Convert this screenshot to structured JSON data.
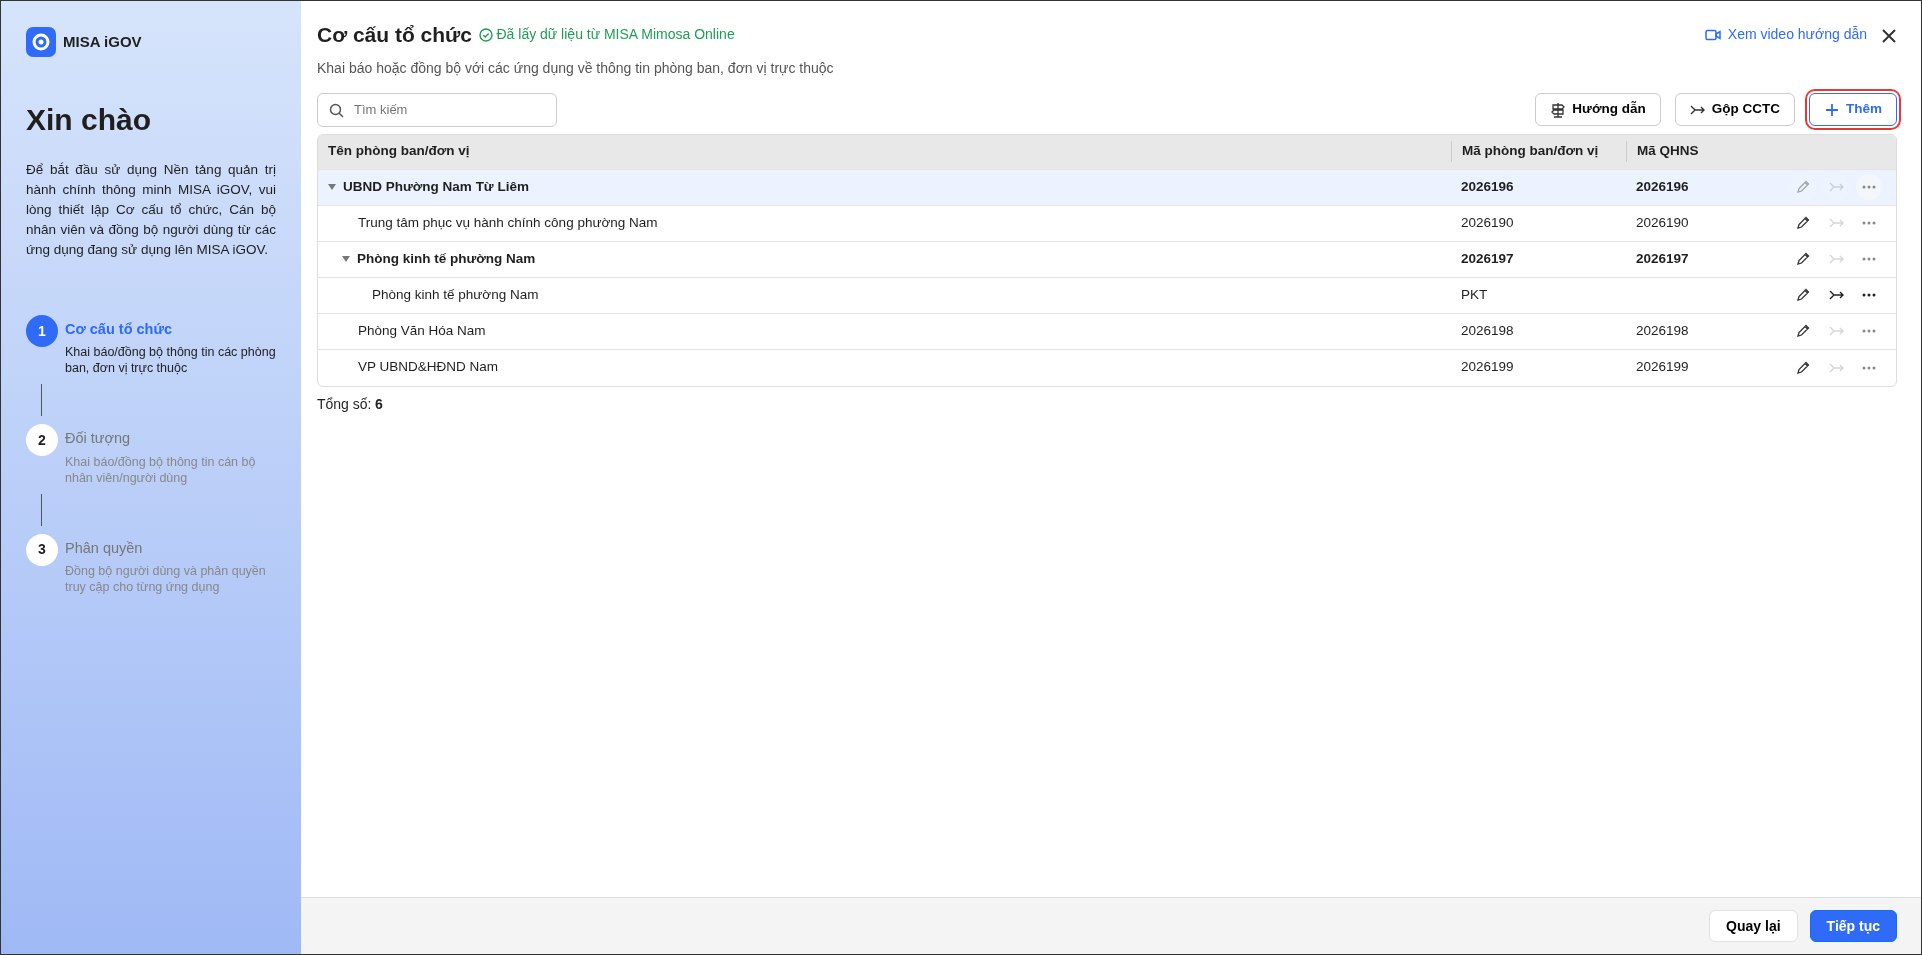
{
  "sidebar": {
    "brand": "MISA iGOV",
    "greeting": "Xin chào",
    "intro": "Để bắt đầu sử dụng Nền tảng quản trị hành chính thông minh MISA iGOV, vui lòng thiết lập Cơ cấu tổ chức, Cán bộ nhân viên và đồng bộ người dùng từ các ứng dụng đang sử dụng lên MISA iGOV.",
    "steps": [
      {
        "number": "1",
        "title": "Cơ cấu tổ chức",
        "description": "Khai báo/đồng bộ thông tin các phòng ban, đơn vị trực thuộc",
        "selected": true
      },
      {
        "number": "2",
        "title": "Đối tượng",
        "description": "Khai báo/đồng bộ thông tin cán bộ nhân viên/người dùng",
        "selected": false
      },
      {
        "number": "3",
        "title": "Phân quyền",
        "description": "Đồng bộ người dùng và phân quyền truy cập cho từng ứng dụng",
        "selected": false
      }
    ]
  },
  "header": {
    "title": "Cơ cấu tổ chức",
    "sync_status": "Đã lấy dữ liệu từ MISA Mimosa Online",
    "subtitle": "Khai báo hoặc đồng bộ với các ứng dụng về thông tin phòng ban, đơn vị trực thuộc",
    "video_link": "Xem video hướng dẫn"
  },
  "search": {
    "placeholder": "Tìm kiếm"
  },
  "toolbar": [
    {
      "kind": "guide",
      "label": "Hướng dẫn",
      "highlighted": false
    },
    {
      "kind": "merge",
      "label": "Gộp CCTC",
      "highlighted": false
    },
    {
      "kind": "add",
      "label": "Thêm",
      "highlighted": true
    }
  ],
  "table": {
    "columns": [
      "Tên phòng ban/đơn vị",
      "Mã phòng ban/đơn vị",
      "Mã QHNS"
    ],
    "rows": [
      {
        "name": "UBND Phường Nam Từ Liêm",
        "code": "2026196",
        "qhns": "2026196",
        "selected": true,
        "expanded": true,
        "edit_enabled": false,
        "merge_enabled": false,
        "children": [
          {
            "name": "Trung tâm phục vụ hành chính công phường Nam",
            "code": "2026190",
            "qhns": "2026190",
            "selected": false,
            "edit_enabled": true,
            "merge_enabled": false
          },
          {
            "name": "Phòng kinh tế phường Nam",
            "code": "2026197",
            "qhns": "2026197",
            "selected": false,
            "expanded": true,
            "edit_enabled": true,
            "merge_enabled": false,
            "children": [
              {
                "name": "Phòng kinh tế phường Nam",
                "code": "PKT",
                "selected": false,
                "edit_enabled": true,
                "merge_enabled": true
              }
            ]
          },
          {
            "name": "Phòng Văn Hóa Nam",
            "code": "2026198",
            "qhns": "2026198",
            "selected": false,
            "edit_enabled": true,
            "merge_enabled": false
          },
          {
            "name": "VP UBND&HĐND Nam",
            "code": "2026199",
            "qhns": "2026199",
            "selected": false,
            "edit_enabled": true,
            "merge_enabled": false
          }
        ]
      }
    ]
  },
  "total": {
    "label": "Tổng số:",
    "value": "6"
  },
  "footer": {
    "back": "Quay lại",
    "next": "Tiếp tục"
  }
}
